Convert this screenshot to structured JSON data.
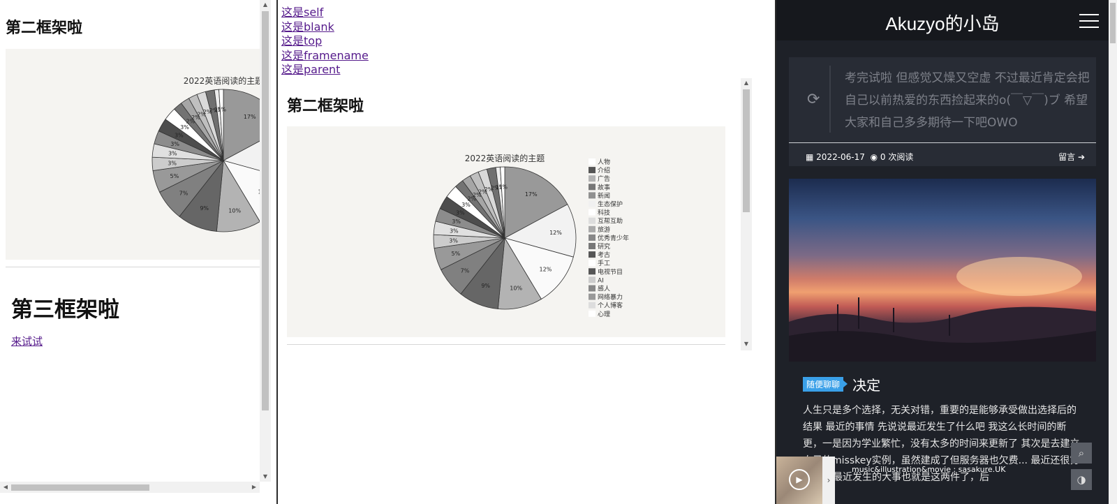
{
  "left": {
    "heading2": "第二框架啦",
    "heading3": "第三框架啦",
    "try_link": "来试试"
  },
  "middle": {
    "links": [
      "这是self",
      "这是blank",
      "这是top",
      "这是framename",
      "这是parent"
    ],
    "heading2": "第二框架啦"
  },
  "chart_data": {
    "type": "pie",
    "title": "2022英语阅读的主题",
    "categories": [
      "人物",
      "介绍",
      "广告",
      "故事",
      "新闻",
      "生态保护",
      "科技",
      "互帮互助",
      "旅游",
      "优秀青少年",
      "研究",
      "考古",
      "手工",
      "电视节目",
      "AI",
      "感人",
      "网络暴力",
      "个人博客",
      "心理"
    ],
    "values": [
      17,
      12,
      12,
      10,
      9,
      7,
      5,
      3,
      3,
      3,
      3,
      3,
      2,
      2,
      2,
      2,
      2,
      1,
      1
    ],
    "value_labels": [
      "17%",
      "12%",
      "12%",
      "10%",
      "9%",
      "7%",
      "5%",
      "3%",
      "3%",
      "3%",
      "3%",
      "3%",
      "2%",
      "2%",
      "2%",
      "2%",
      "2%",
      "1%",
      "1%"
    ],
    "legend": "right",
    "colors": [
      "#999999",
      "#f2f2f2",
      "#fafafa",
      "#b3b3b3",
      "#666666",
      "#808080",
      "#999999",
      "#cccccc",
      "#e0e0e0",
      "#8c8c8c",
      "#4d4d4d",
      "#ffffff",
      "#737373",
      "#a6a6a6",
      "#bfbfbf",
      "#d9d9d9",
      "#707070",
      "#ececec",
      "#ffffff"
    ],
    "legend_colors": [
      "#ffffff",
      "#555555",
      "#b3b3b3",
      "#777777",
      "#909090",
      "#f0f0f0",
      "#ffffff",
      "#dddddd",
      "#aaaaaa",
      "#888888",
      "#777777",
      "#555555",
      "#ffffff",
      "#555555",
      "#cccccc",
      "#888888",
      "#999999",
      "#dddddd",
      "#ffffff"
    ]
  },
  "blog": {
    "brand": "Akuzyo的小岛",
    "quote": "考完试啦 但感觉又燥又空虚 不过最近肯定会把自己以前热爱的东西捡起来的o(￣▽￣)ブ 希望大家和自己多多期待一下吧OWO",
    "date": "2022-06-17",
    "views": "0 次阅读",
    "comment": "留言",
    "post_tag": "随便聊聊",
    "post_title": "决定",
    "post_excerpt": "人生只是多个选择，无关对错，重要的是能够承受做出选择后的结果 最近的事情 先说说最近发生了什么吧 我这么长时间的断更，一是因为学业繁忙，没有太多的时间来更新了 其次是去建立自己的misskey实例，虽然建成了但服务器也欠费... 最近还很穷TAT） 最近发生的大事也就是这两件了，后",
    "player_text": "music&illustration&movie : sasakure.UK",
    "accent": "#3aa0e8"
  }
}
